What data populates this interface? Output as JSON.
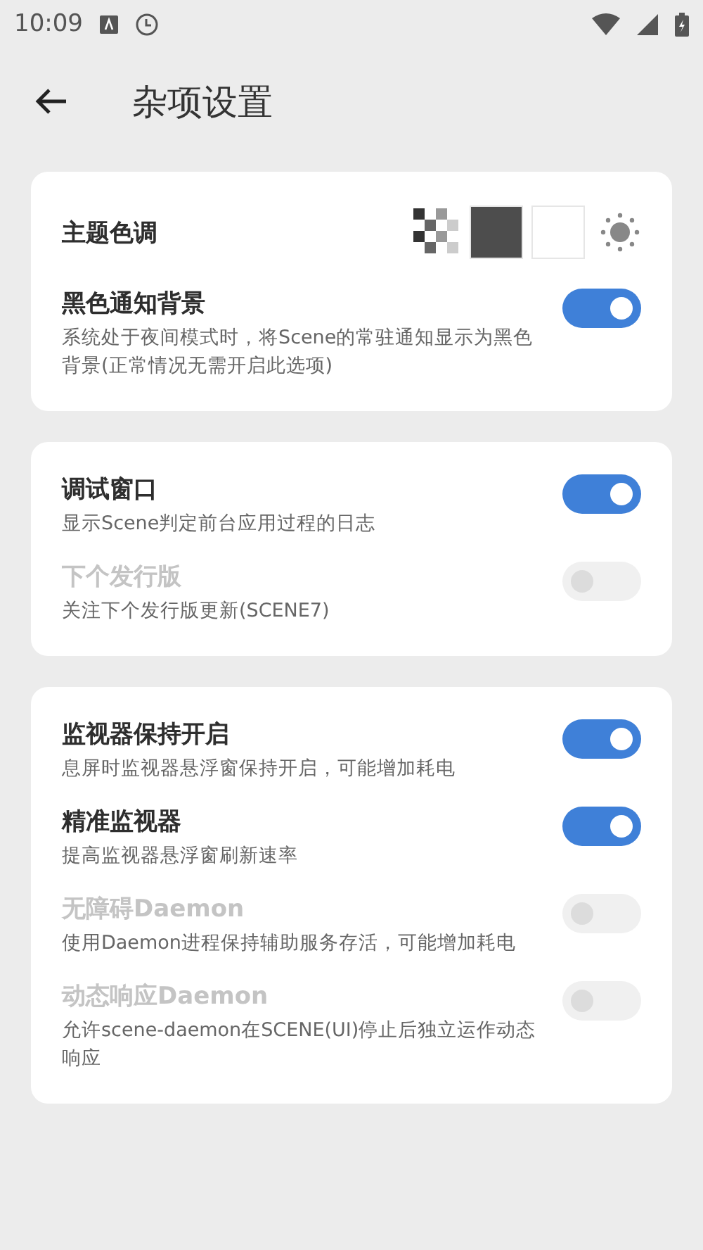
{
  "status_bar": {
    "time": "10:09"
  },
  "header": {
    "title": "杂项设置"
  },
  "cards": [
    {
      "items": [
        {
          "kind": "theme",
          "title": "主题色调"
        },
        {
          "kind": "switch",
          "title": "黑色通知背景",
          "description": "系统处于夜间模式时，将Scene的常驻通知显示为黑色背景(正常情况无需开启此选项)",
          "on": true,
          "disabled": false
        }
      ]
    },
    {
      "items": [
        {
          "kind": "switch",
          "title": "调试窗口",
          "description": "显示Scene判定前台应用过程的日志",
          "on": true,
          "disabled": false
        },
        {
          "kind": "switch",
          "title": "下个发行版",
          "description": "关注下个发行版更新(SCENE7)",
          "on": false,
          "disabled": true
        }
      ]
    },
    {
      "items": [
        {
          "kind": "switch",
          "title": "监视器保持开启",
          "description": "息屏时监视器悬浮窗保持开启，可能增加耗电",
          "on": true,
          "disabled": false
        },
        {
          "kind": "switch",
          "title": "精准监视器",
          "description": "提高监视器悬浮窗刷新速率",
          "on": true,
          "disabled": false
        },
        {
          "kind": "switch",
          "title": "无障碍Daemon",
          "description": "使用Daemon进程保持辅助服务存活，可能增加耗电",
          "on": false,
          "disabled": true
        },
        {
          "kind": "switch",
          "title": "动态响应Daemon",
          "description": "允许scene-daemon在SCENE(UI)停止后独立运作动态响应",
          "on": false,
          "disabled": true
        }
      ]
    }
  ]
}
